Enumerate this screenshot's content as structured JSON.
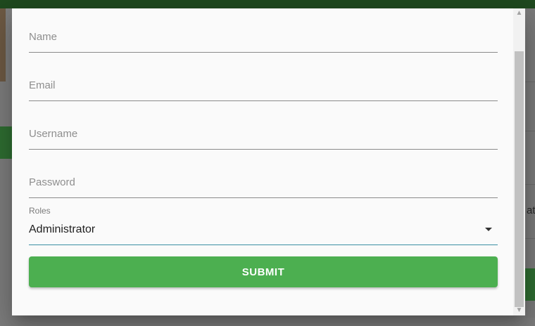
{
  "background": {
    "partial_text": "at"
  },
  "form": {
    "name": {
      "placeholder": "Name",
      "value": ""
    },
    "email": {
      "placeholder": "Email",
      "value": ""
    },
    "username": {
      "placeholder": "Username",
      "value": ""
    },
    "password": {
      "placeholder": "Password",
      "value": ""
    },
    "roles": {
      "label": "Roles",
      "selected": "Administrator"
    },
    "submit_label": "SUBMIT"
  },
  "scrollbar": {
    "up_icon": "chevron-up-icon",
    "down_icon": "chevron-down-icon"
  },
  "colors": {
    "accent": "#4caf50",
    "select_underline": "#3a8fa3",
    "header": "#1f4a1f"
  }
}
